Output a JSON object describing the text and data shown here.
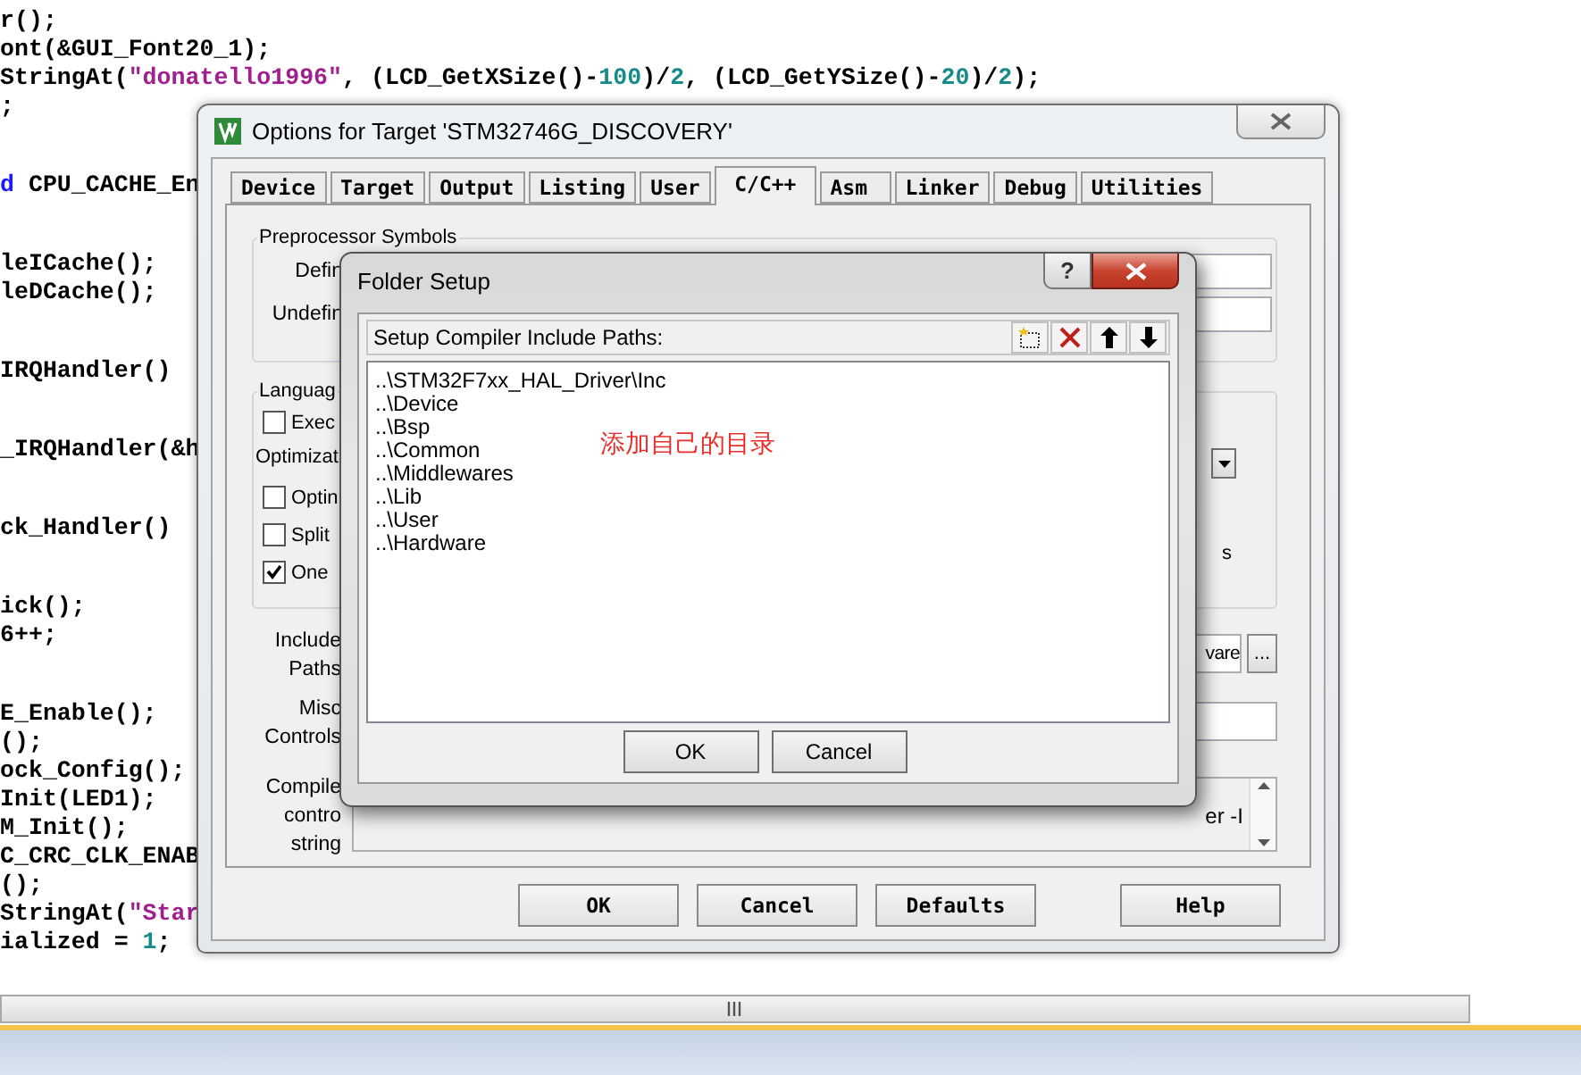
{
  "editor": {
    "blocks": [
      {
        "lines": [
          [
            {
              "kind": "plain",
              "text": "r();"
            }
          ],
          [
            {
              "kind": "plain",
              "text": "ont(&GUI_Font20_1);"
            }
          ],
          [
            {
              "kind": "plain",
              "text": "StringAt("
            },
            {
              "kind": "string",
              "text": "\"donatello1996\""
            },
            {
              "kind": "plain",
              "text": ", (LCD_GetXSize()-"
            },
            {
              "kind": "number",
              "text": "100"
            },
            {
              "kind": "plain",
              "text": ")/"
            },
            {
              "kind": "number",
              "text": "2"
            },
            {
              "kind": "plain",
              "text": ", (LCD_GetYSize()-"
            },
            {
              "kind": "number",
              "text": "20"
            },
            {
              "kind": "plain",
              "text": ")/"
            },
            {
              "kind": "number",
              "text": "2"
            },
            {
              "kind": "plain",
              "text": ");"
            }
          ],
          [
            {
              "kind": "plain",
              "text": ";"
            }
          ]
        ]
      },
      {
        "lines": [
          [
            {
              "kind": "keyword",
              "text": "d"
            },
            {
              "kind": "plain",
              "text": " CPU_CACHE_En"
            }
          ]
        ]
      },
      {
        "lines": [
          [
            {
              "kind": "plain",
              "text": "leICache();"
            }
          ],
          [
            {
              "kind": "plain",
              "text": "leDCache();"
            }
          ]
        ]
      },
      {
        "lines": [
          [
            {
              "kind": "plain",
              "text": "IRQHandler()"
            }
          ]
        ]
      },
      {
        "lines": [
          [
            {
              "kind": "plain",
              "text": "_IRQHandler(&h"
            }
          ]
        ]
      },
      {
        "lines": [
          [
            {
              "kind": "plain",
              "text": "ck_Handler()"
            }
          ]
        ]
      },
      {
        "lines": [
          [
            {
              "kind": "plain",
              "text": "ick();"
            }
          ],
          [
            {
              "kind": "plain",
              "text": "6++;"
            }
          ]
        ]
      },
      {
        "lines": [
          [
            {
              "kind": "plain",
              "text": "E_Enable();"
            }
          ],
          [
            {
              "kind": "plain",
              "text": "();"
            }
          ],
          [
            {
              "kind": "plain",
              "text": "ock_Config();"
            }
          ],
          [
            {
              "kind": "plain",
              "text": "Init(LED1);"
            }
          ],
          [
            {
              "kind": "plain",
              "text": "M_Init();"
            }
          ],
          [
            {
              "kind": "plain",
              "text": "C_CRC_CLK_ENAB"
            }
          ],
          [
            {
              "kind": "plain",
              "text": "();"
            }
          ],
          [
            {
              "kind": "plain",
              "text": "StringAt("
            },
            {
              "kind": "string",
              "text": "\"Star"
            }
          ],
          [
            {
              "kind": "plain",
              "text": "ialized = "
            },
            {
              "kind": "number",
              "text": "1"
            },
            {
              "kind": "plain",
              "text": ";"
            }
          ]
        ]
      }
    ]
  },
  "options_dialog": {
    "title": "Options for Target 'STM32746G_DISCOVERY'",
    "tabs": [
      {
        "label": "Device",
        "selected": false
      },
      {
        "label": "Target",
        "selected": false
      },
      {
        "label": "Output",
        "selected": false
      },
      {
        "label": "Listing",
        "selected": false
      },
      {
        "label": "User",
        "selected": false
      },
      {
        "label": "C/C++",
        "selected": true
      },
      {
        "label": "Asm",
        "selected": false
      },
      {
        "label": "Linker",
        "selected": false
      },
      {
        "label": "Debug",
        "selected": false
      },
      {
        "label": "Utilities",
        "selected": false
      }
    ],
    "preprocessor": {
      "title": "Preprocessor Symbols",
      "define_label": "Defin",
      "undefine_label": "Undefin"
    },
    "language": {
      "title": "Languag",
      "items": [
        {
          "kind": "checkbox",
          "label": "Exec",
          "checked": false
        },
        {
          "kind": "label",
          "label": "Optimizat"
        },
        {
          "kind": "checkbox",
          "label": "Optin",
          "checked": false
        },
        {
          "kind": "checkbox",
          "label": "Split",
          "checked": false
        },
        {
          "kind": "checkbox",
          "label": "One",
          "checked": true
        }
      ],
      "right_fragment": "s"
    },
    "include_paths": {
      "label": "Include Paths",
      "value": "vare",
      "browse": "..."
    },
    "misc_controls": {
      "label": "Misc Controls"
    },
    "compiler_string": {
      "label": "Compile contro string",
      "value": "er -I"
    },
    "buttons": [
      "OK",
      "Cancel",
      "Defaults",
      "Help"
    ]
  },
  "folder_dialog": {
    "title": "Folder Setup",
    "help": "?",
    "list_title": "Setup Compiler Include Paths:",
    "paths": [
      "..\\STM32F7xx_HAL_Driver\\Inc",
      "..\\Device",
      "..\\Bsp",
      "..\\Common",
      "..\\Middlewares",
      "..\\Lib",
      "..\\User",
      "..\\Hardware"
    ],
    "annotation": "添加自己的目录",
    "buttons": [
      "OK",
      "Cancel"
    ]
  }
}
